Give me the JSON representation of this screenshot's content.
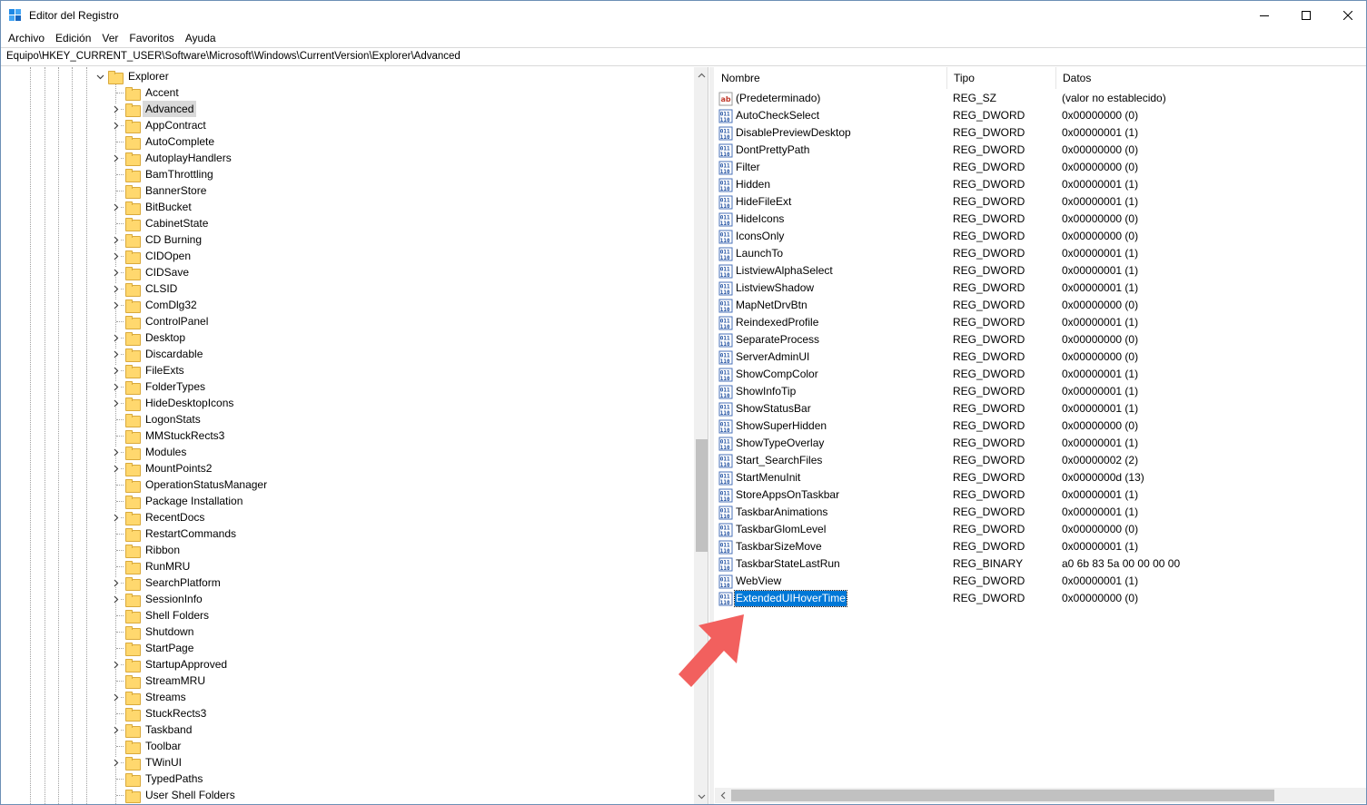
{
  "window": {
    "title": "Editor del Registro",
    "controls": {
      "minimize": "minimize-icon",
      "maximize": "maximize-icon",
      "close": "close-icon"
    }
  },
  "menu": [
    "Archivo",
    "Edición",
    "Ver",
    "Favoritos",
    "Ayuda"
  ],
  "address": "Equipo\\HKEY_CURRENT_USER\\Software\\Microsoft\\Windows\\CurrentVersion\\Explorer\\Advanced",
  "tree": {
    "parent": "Explorer",
    "selected": "Advanced",
    "children": [
      {
        "label": "Accent",
        "expandable": false
      },
      {
        "label": "Advanced",
        "expandable": true
      },
      {
        "label": "AppContract",
        "expandable": true
      },
      {
        "label": "AutoComplete",
        "expandable": false
      },
      {
        "label": "AutoplayHandlers",
        "expandable": true
      },
      {
        "label": "BamThrottling",
        "expandable": false
      },
      {
        "label": "BannerStore",
        "expandable": false
      },
      {
        "label": "BitBucket",
        "expandable": true
      },
      {
        "label": "CabinetState",
        "expandable": false
      },
      {
        "label": "CD Burning",
        "expandable": true
      },
      {
        "label": "CIDOpen",
        "expandable": true
      },
      {
        "label": "CIDSave",
        "expandable": true
      },
      {
        "label": "CLSID",
        "expandable": true
      },
      {
        "label": "ComDlg32",
        "expandable": true
      },
      {
        "label": "ControlPanel",
        "expandable": false
      },
      {
        "label": "Desktop",
        "expandable": true
      },
      {
        "label": "Discardable",
        "expandable": true
      },
      {
        "label": "FileExts",
        "expandable": true
      },
      {
        "label": "FolderTypes",
        "expandable": true
      },
      {
        "label": "HideDesktopIcons",
        "expandable": true
      },
      {
        "label": "LogonStats",
        "expandable": false
      },
      {
        "label": "MMStuckRects3",
        "expandable": false
      },
      {
        "label": "Modules",
        "expandable": true
      },
      {
        "label": "MountPoints2",
        "expandable": true
      },
      {
        "label": "OperationStatusManager",
        "expandable": false
      },
      {
        "label": "Package Installation",
        "expandable": false
      },
      {
        "label": "RecentDocs",
        "expandable": true
      },
      {
        "label": "RestartCommands",
        "expandable": false
      },
      {
        "label": "Ribbon",
        "expandable": false
      },
      {
        "label": "RunMRU",
        "expandable": false
      },
      {
        "label": "SearchPlatform",
        "expandable": true
      },
      {
        "label": "SessionInfo",
        "expandable": true
      },
      {
        "label": "Shell Folders",
        "expandable": false
      },
      {
        "label": "Shutdown",
        "expandable": false
      },
      {
        "label": "StartPage",
        "expandable": false
      },
      {
        "label": "StartupApproved",
        "expandable": true
      },
      {
        "label": "StreamMRU",
        "expandable": false
      },
      {
        "label": "Streams",
        "expandable": true
      },
      {
        "label": "StuckRects3",
        "expandable": false
      },
      {
        "label": "Taskband",
        "expandable": true
      },
      {
        "label": "Toolbar",
        "expandable": false
      },
      {
        "label": "TWinUI",
        "expandable": true
      },
      {
        "label": "TypedPaths",
        "expandable": false
      },
      {
        "label": "User Shell Folders",
        "expandable": false
      }
    ]
  },
  "list": {
    "columns": [
      "Nombre",
      "Tipo",
      "Datos"
    ],
    "rows": [
      {
        "name": "(Predeterminado)",
        "type": "REG_SZ",
        "data": "(valor no establecido)",
        "icon": "string-value-icon"
      },
      {
        "name": "AutoCheckSelect",
        "type": "REG_DWORD",
        "data": "0x00000000 (0)",
        "icon": "binary-value-icon"
      },
      {
        "name": "DisablePreviewDesktop",
        "type": "REG_DWORD",
        "data": "0x00000001 (1)",
        "icon": "binary-value-icon"
      },
      {
        "name": "DontPrettyPath",
        "type": "REG_DWORD",
        "data": "0x00000000 (0)",
        "icon": "binary-value-icon"
      },
      {
        "name": "Filter",
        "type": "REG_DWORD",
        "data": "0x00000000 (0)",
        "icon": "binary-value-icon"
      },
      {
        "name": "Hidden",
        "type": "REG_DWORD",
        "data": "0x00000001 (1)",
        "icon": "binary-value-icon"
      },
      {
        "name": "HideFileExt",
        "type": "REG_DWORD",
        "data": "0x00000001 (1)",
        "icon": "binary-value-icon"
      },
      {
        "name": "HideIcons",
        "type": "REG_DWORD",
        "data": "0x00000000 (0)",
        "icon": "binary-value-icon"
      },
      {
        "name": "IconsOnly",
        "type": "REG_DWORD",
        "data": "0x00000000 (0)",
        "icon": "binary-value-icon"
      },
      {
        "name": "LaunchTo",
        "type": "REG_DWORD",
        "data": "0x00000001 (1)",
        "icon": "binary-value-icon"
      },
      {
        "name": "ListviewAlphaSelect",
        "type": "REG_DWORD",
        "data": "0x00000001 (1)",
        "icon": "binary-value-icon"
      },
      {
        "name": "ListviewShadow",
        "type": "REG_DWORD",
        "data": "0x00000001 (1)",
        "icon": "binary-value-icon"
      },
      {
        "name": "MapNetDrvBtn",
        "type": "REG_DWORD",
        "data": "0x00000000 (0)",
        "icon": "binary-value-icon"
      },
      {
        "name": "ReindexedProfile",
        "type": "REG_DWORD",
        "data": "0x00000001 (1)",
        "icon": "binary-value-icon"
      },
      {
        "name": "SeparateProcess",
        "type": "REG_DWORD",
        "data": "0x00000000 (0)",
        "icon": "binary-value-icon"
      },
      {
        "name": "ServerAdminUI",
        "type": "REG_DWORD",
        "data": "0x00000000 (0)",
        "icon": "binary-value-icon"
      },
      {
        "name": "ShowCompColor",
        "type": "REG_DWORD",
        "data": "0x00000001 (1)",
        "icon": "binary-value-icon"
      },
      {
        "name": "ShowInfoTip",
        "type": "REG_DWORD",
        "data": "0x00000001 (1)",
        "icon": "binary-value-icon"
      },
      {
        "name": "ShowStatusBar",
        "type": "REG_DWORD",
        "data": "0x00000001 (1)",
        "icon": "binary-value-icon"
      },
      {
        "name": "ShowSuperHidden",
        "type": "REG_DWORD",
        "data": "0x00000000 (0)",
        "icon": "binary-value-icon"
      },
      {
        "name": "ShowTypeOverlay",
        "type": "REG_DWORD",
        "data": "0x00000001 (1)",
        "icon": "binary-value-icon"
      },
      {
        "name": "Start_SearchFiles",
        "type": "REG_DWORD",
        "data": "0x00000002 (2)",
        "icon": "binary-value-icon"
      },
      {
        "name": "StartMenuInit",
        "type": "REG_DWORD",
        "data": "0x0000000d (13)",
        "icon": "binary-value-icon"
      },
      {
        "name": "StoreAppsOnTaskbar",
        "type": "REG_DWORD",
        "data": "0x00000001 (1)",
        "icon": "binary-value-icon"
      },
      {
        "name": "TaskbarAnimations",
        "type": "REG_DWORD",
        "data": "0x00000001 (1)",
        "icon": "binary-value-icon"
      },
      {
        "name": "TaskbarGlomLevel",
        "type": "REG_DWORD",
        "data": "0x00000000 (0)",
        "icon": "binary-value-icon"
      },
      {
        "name": "TaskbarSizeMove",
        "type": "REG_DWORD",
        "data": "0x00000001 (1)",
        "icon": "binary-value-icon"
      },
      {
        "name": "TaskbarStateLastRun",
        "type": "REG_BINARY",
        "data": "a0 6b 83 5a 00 00 00 00",
        "icon": "binary-value-icon"
      },
      {
        "name": "WebView",
        "type": "REG_DWORD",
        "data": "0x00000001 (1)",
        "icon": "binary-value-icon"
      },
      {
        "name": "ExtendedUIHoverTime",
        "type": "REG_DWORD",
        "data": "0x00000000 (0)",
        "icon": "binary-value-icon",
        "selected": true
      }
    ]
  },
  "colors": {
    "selection": "#0078d7",
    "tree_selection": "#d9d9d9",
    "folder": "#ffd86e",
    "annotation_arrow": "#f2605e"
  },
  "annotation": {
    "icon": "pointer-arrow-icon"
  }
}
